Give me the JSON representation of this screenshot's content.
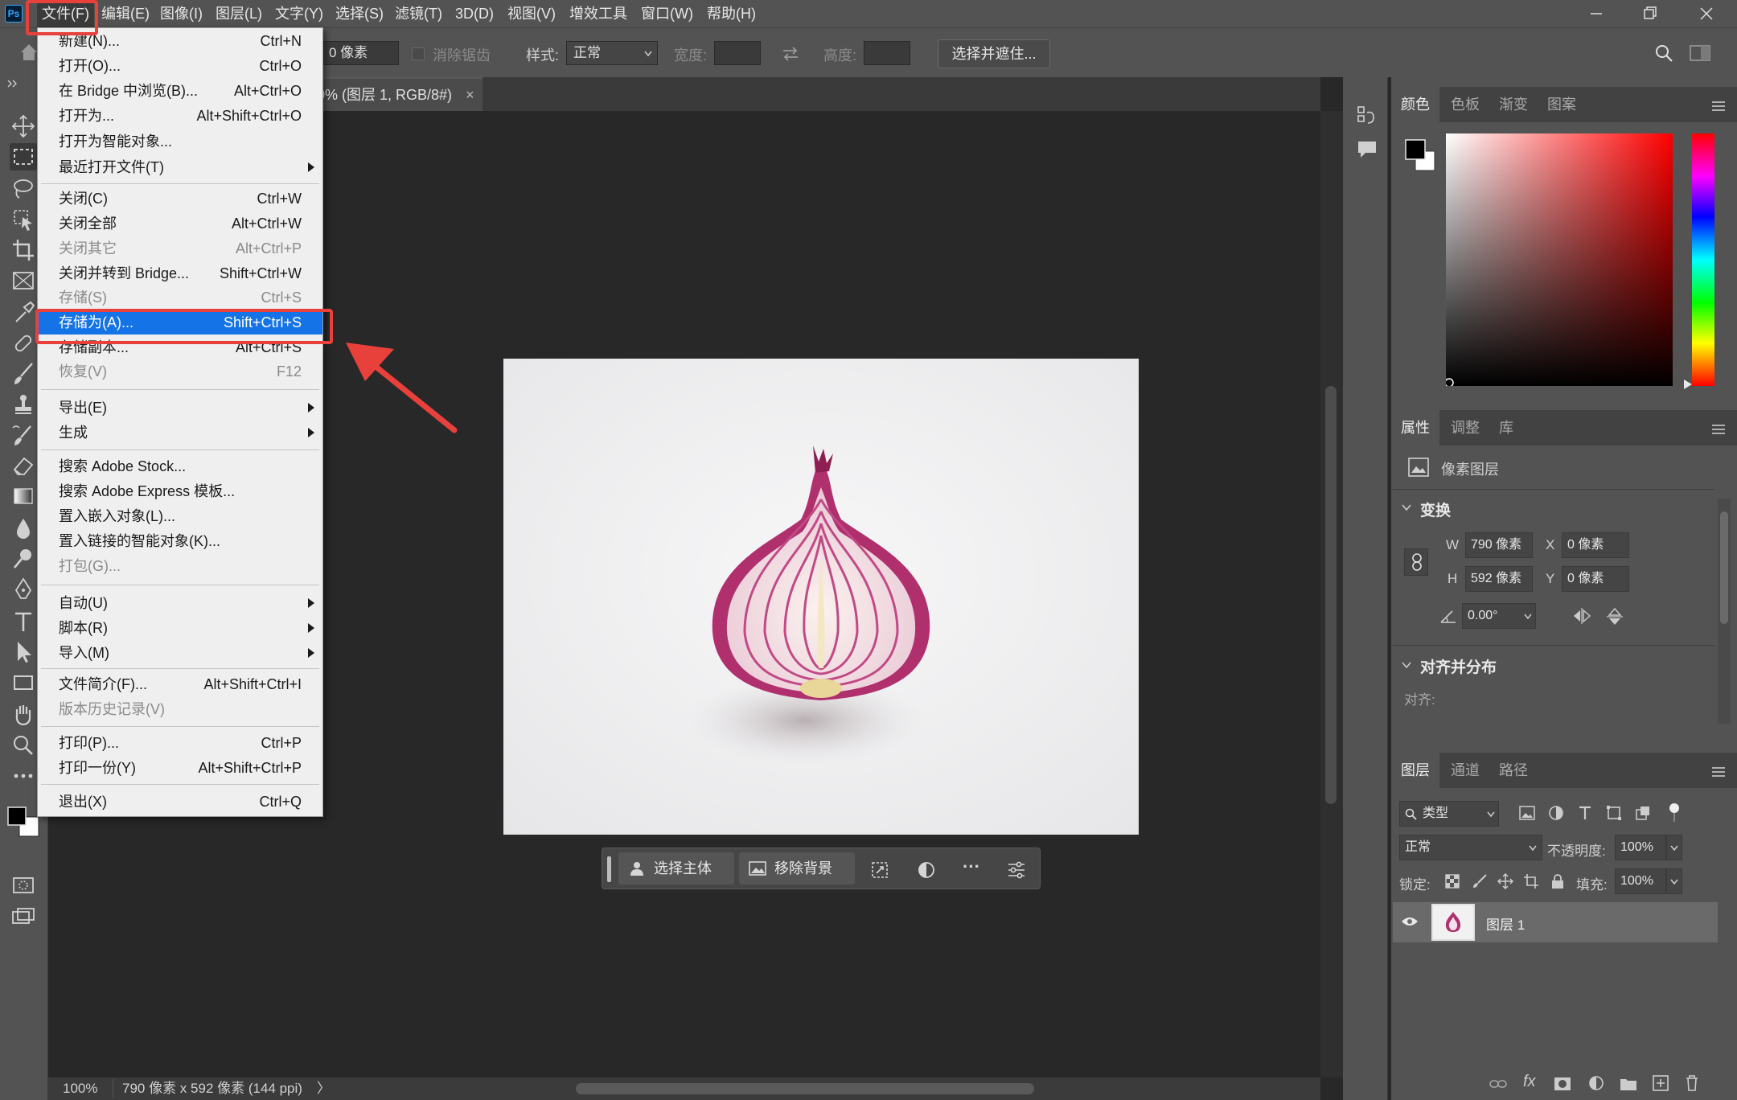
{
  "menubar": {
    "logo": "Ps",
    "items": [
      "文件(F)",
      "编辑(E)",
      "图像(I)",
      "图层(L)",
      "文字(Y)",
      "选择(S)",
      "滤镜(T)",
      "3D(D)",
      "视图(V)",
      "增效工具",
      "窗口(W)",
      "帮助(H)"
    ]
  },
  "options": {
    "feather_value": "0 像素",
    "antialias": "消除锯齿",
    "style_label": "样式:",
    "style_value": "正常",
    "width_label": "宽度:",
    "height_label": "高度:",
    "select_mask_button": "选择并遮住..."
  },
  "document": {
    "tab_title": "0% (图层 1, RGB/8#)",
    "close_glyph": "×"
  },
  "filemenu": {
    "items": [
      {
        "label": "新建(N)...",
        "shortcut": "Ctrl+N"
      },
      {
        "label": "打开(O)...",
        "shortcut": "Ctrl+O"
      },
      {
        "label": "在 Bridge 中浏览(B)...",
        "shortcut": "Alt+Ctrl+O"
      },
      {
        "label": "打开为...",
        "shortcut": "Alt+Shift+Ctrl+O"
      },
      {
        "label": "打开为智能对象...",
        "shortcut": ""
      },
      {
        "label": "最近打开文件(T)",
        "shortcut": ""
      },
      {
        "label": "关闭(C)",
        "shortcut": "Ctrl+W"
      },
      {
        "label": "关闭全部",
        "shortcut": "Alt+Ctrl+W"
      },
      {
        "label": "关闭其它",
        "shortcut": "Alt+Ctrl+P"
      },
      {
        "label": "关闭并转到 Bridge...",
        "shortcut": "Shift+Ctrl+W"
      },
      {
        "label": "存储(S)",
        "shortcut": "Ctrl+S"
      },
      {
        "label": "存储为(A)...",
        "shortcut": "Shift+Ctrl+S"
      },
      {
        "label": "存储副本...",
        "shortcut": "Alt+Ctrl+S"
      },
      {
        "label": "恢复(V)",
        "shortcut": "F12"
      },
      {
        "label": "导出(E)",
        "shortcut": ""
      },
      {
        "label": "生成",
        "shortcut": ""
      },
      {
        "label": "搜索 Adobe Stock...",
        "shortcut": ""
      },
      {
        "label": "搜索 Adobe Express 模板...",
        "shortcut": ""
      },
      {
        "label": "置入嵌入对象(L)...",
        "shortcut": ""
      },
      {
        "label": "置入链接的智能对象(K)...",
        "shortcut": ""
      },
      {
        "label": "打包(G)...",
        "shortcut": ""
      },
      {
        "label": "自动(U)",
        "shortcut": ""
      },
      {
        "label": "脚本(R)",
        "shortcut": ""
      },
      {
        "label": "导入(M)",
        "shortcut": ""
      },
      {
        "label": "文件简介(F)...",
        "shortcut": "Alt+Shift+Ctrl+I"
      },
      {
        "label": "版本历史记录(V)",
        "shortcut": ""
      },
      {
        "label": "打印(P)...",
        "shortcut": "Ctrl+P"
      },
      {
        "label": "打印一份(Y)",
        "shortcut": "Alt+Shift+Ctrl+P"
      },
      {
        "label": "退出(X)",
        "shortcut": "Ctrl+Q"
      }
    ]
  },
  "taskbar": {
    "select_subject": "选择主体",
    "remove_bg": "移除背景",
    "more": "···"
  },
  "status": {
    "zoom": "100%",
    "doc_info": "790 像素 x 592 像素 (144 ppi)",
    "arrow": "〉"
  },
  "color_panel": {
    "tabs": [
      "颜色",
      "色板",
      "渐变",
      "图案"
    ]
  },
  "properties_panel": {
    "tabs": [
      "属性",
      "调整",
      "库"
    ],
    "layer_type": "像素图层",
    "transform_title": "变换",
    "w_label": "W",
    "w_value": "790 像素",
    "h_label": "H",
    "h_value": "592 像素",
    "x_label": "X",
    "x_value": "0 像素",
    "y_label": "Y",
    "y_value": "0 像素",
    "angle_value": "0.00°",
    "align_title": "对齐并分布",
    "align_label": "对齐:"
  },
  "layers_panel": {
    "tabs": [
      "图层",
      "通道",
      "路径"
    ],
    "filter_label": "类型",
    "blend_mode": "正常",
    "opacity_label": "不透明度:",
    "opacity_value": "100%",
    "lock_label": "锁定:",
    "fill_label": "填充:",
    "fill_value": "100%",
    "layers": [
      {
        "name": "图层 1"
      }
    ]
  },
  "colors": {
    "accent": "#1473e6",
    "annotation": "#e8413c",
    "menubar": "#535353",
    "canvas": "#282828"
  }
}
